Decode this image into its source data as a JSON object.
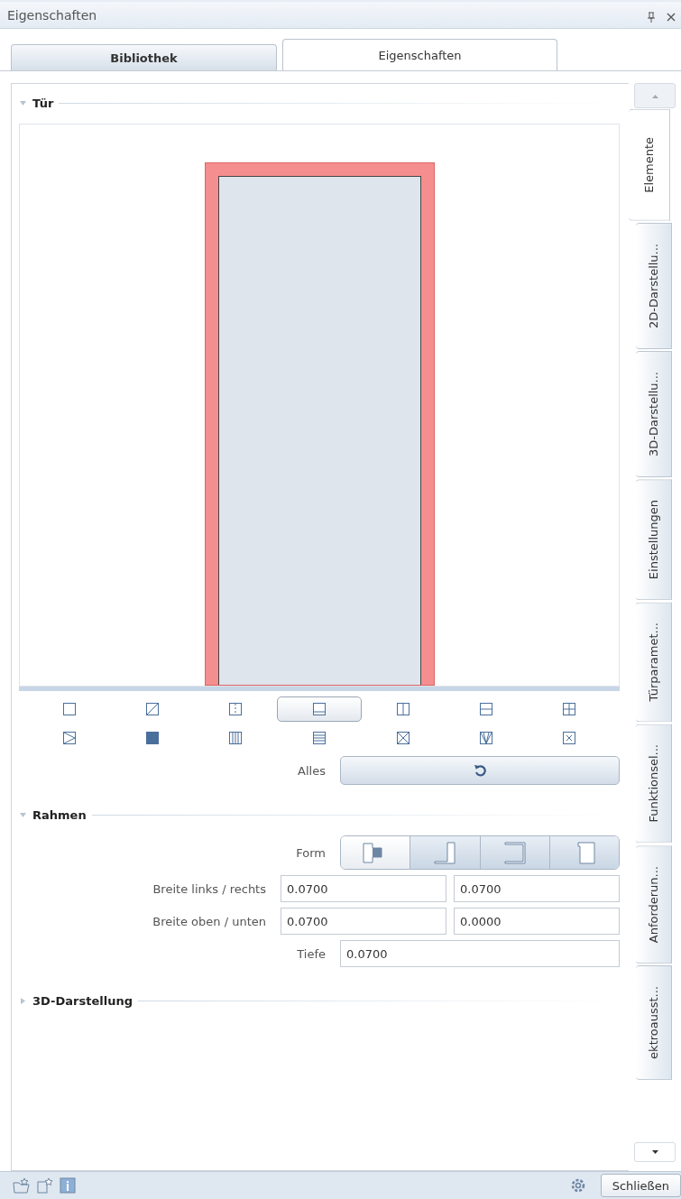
{
  "window": {
    "title": "Eigenschaften"
  },
  "top_tabs": [
    {
      "label": "Bibliothek",
      "selected": false
    },
    {
      "label": "Eigenschaften",
      "selected": true
    }
  ],
  "door_section": {
    "title": "Tür",
    "expanded": true
  },
  "door_styles": [
    {
      "kind": "blank",
      "selected": false
    },
    {
      "kind": "diagonal",
      "selected": false
    },
    {
      "kind": "dashed",
      "selected": false
    },
    {
      "kind": "top-bar",
      "selected": true
    },
    {
      "kind": "two-panel",
      "selected": false
    },
    {
      "kind": "h-split",
      "selected": false
    },
    {
      "kind": "four-panel",
      "selected": false
    },
    {
      "kind": "triangle",
      "selected": false
    },
    {
      "kind": "filled",
      "selected": false
    },
    {
      "kind": "v-lines",
      "selected": false
    },
    {
      "kind": "h-lines",
      "selected": false
    },
    {
      "kind": "cross",
      "selected": false
    },
    {
      "kind": "fan",
      "selected": false
    },
    {
      "kind": "small-cross",
      "selected": false
    }
  ],
  "reset_row": {
    "label": "Alles"
  },
  "frame_section": {
    "title": "Rahmen",
    "expanded": true,
    "form_label": "Form",
    "shapes": [
      {
        "kind": "both",
        "selected": true
      },
      {
        "kind": "right",
        "selected": false
      },
      {
        "kind": "right-bottom",
        "selected": false
      },
      {
        "kind": "right-top",
        "selected": false
      }
    ],
    "rows": [
      {
        "label": "Breite links / rechts",
        "values": [
          "0.0700",
          "0.0700"
        ]
      },
      {
        "label": "Breite oben / unten",
        "values": [
          "0.0700",
          "0.0000"
        ]
      },
      {
        "label": "Tiefe",
        "values": [
          "0.0700"
        ]
      }
    ]
  },
  "display_section": {
    "title": "3D-Darstellung",
    "expanded": false
  },
  "side_tabs": [
    {
      "label": "Elemente",
      "selected": true
    },
    {
      "label": "2D-Darstellu...",
      "selected": false
    },
    {
      "label": "3D-Darstellu...",
      "selected": false
    },
    {
      "label": "Einstellungen",
      "selected": false
    },
    {
      "label": "Türparamet...",
      "selected": false
    },
    {
      "label": "Funktionsel...",
      "selected": false
    },
    {
      "label": "Anforderun...",
      "selected": false
    },
    {
      "label": "ektroausst...",
      "selected": false
    }
  ],
  "footer": {
    "close_button": "Schließen"
  }
}
